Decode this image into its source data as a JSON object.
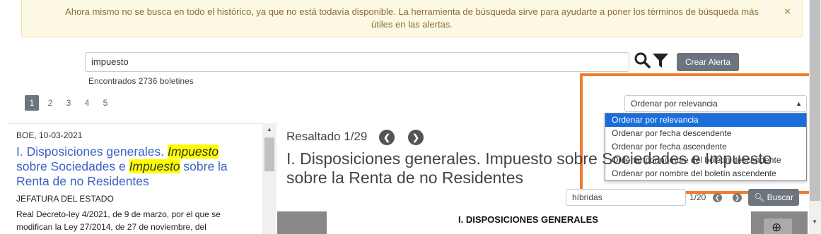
{
  "alert": {
    "message": "Ahora mismo no se busca en todo el histórico, ya que no está todavía disponible. La herramienta de búsqueda sirve para ayudarte a poner los términos de búsqueda más útiles en las alertas.",
    "close": "×"
  },
  "search": {
    "value": "impuesto",
    "create_alert_label": "Crear Alerta",
    "found_text": "Encontrados 2736 boletines"
  },
  "pagination": {
    "pages": [
      "1",
      "2",
      "3",
      "4",
      "5"
    ],
    "current": "1"
  },
  "sort": {
    "selected": "Ordenar por relevancia",
    "options": [
      "Ordenar por relevancia",
      "Ordenar por fecha descendente",
      "Ordenar por fecha ascendente",
      "Ordenar por nombre del boletín descendente",
      "Ordenar por nombre del boletín ascendente"
    ]
  },
  "result": {
    "date": "BOE, 10-03-2021",
    "title_part1": "I. Disposiciones generales. ",
    "title_hl1": "Impuesto",
    "title_part2": " sobre Sociedades e ",
    "title_hl2": "Impuesto",
    "title_part3": " sobre la Renta de no Residentes",
    "department": "JEFATURA DEL ESTADO",
    "description": "Real Decreto-ley 4/2021, de 9 de marzo, por el que se modifican la Ley 27/2014, de 27 de noviembre, del"
  },
  "viewer": {
    "resaltado": "Resaltado 1/29",
    "doc_title_line1": "I. Disposiciones generales. Impuesto sobre Sociedades e Impuesto",
    "doc_title_line2": "sobre la Renta de no Residentes",
    "highlight_term": "híbridas",
    "highlight_count": "1/20",
    "buscar_label": "Buscar",
    "doc_heading": "I. DISPOSICIONES GENERALES"
  },
  "colors": {
    "accent_orange": "#f07c2a",
    "link_blue": "#3a63c3",
    "button_gray": "#6c757d",
    "dropdown_selected": "#1a6ddb",
    "highlight_yellow": "#ffff00"
  }
}
